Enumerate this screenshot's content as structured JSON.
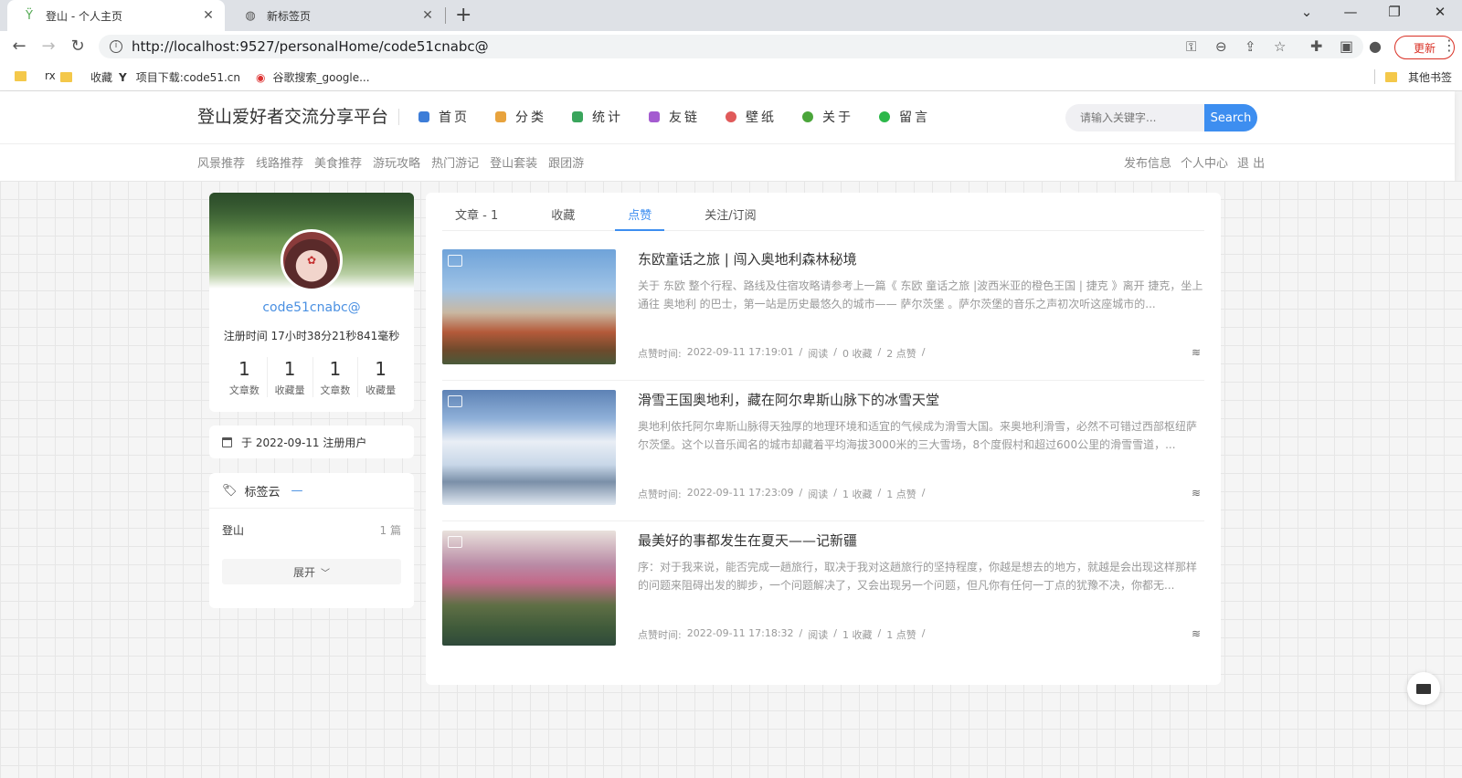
{
  "browser": {
    "tabs": [
      {
        "title": "登山 - 个人主页",
        "active": true
      },
      {
        "title": "新标签页",
        "active": false
      }
    ],
    "url": "http://localhost:9527/personalHome/code51cnabc@",
    "update_label": "更新",
    "bookmarks": [
      "rx",
      "收藏",
      "项目下载:code51.cn",
      "谷歌搜索_google..."
    ],
    "other_bookmarks": "其他书签"
  },
  "header": {
    "site_title": "登山爱好者交流分享平台",
    "nav": [
      {
        "label": "首页",
        "icon": "grid-icon",
        "color": "#3d7dd8"
      },
      {
        "label": "分类",
        "icon": "category-icon",
        "color": "#e8a33d"
      },
      {
        "label": "统计",
        "icon": "stats-icon",
        "color": "#3aa55c"
      },
      {
        "label": "友链",
        "icon": "link-icon",
        "color": "#a45bd0"
      },
      {
        "label": "壁纸",
        "icon": "wallpaper-icon",
        "color": "#e05a5a"
      },
      {
        "label": "关于",
        "icon": "info-icon",
        "color": "#4aa53a"
      },
      {
        "label": "留言",
        "icon": "message-icon",
        "color": "#2db84a"
      }
    ],
    "search_placeholder": "请输入关键字...",
    "search_button": "Search",
    "subnav": [
      "风景推荐",
      "线路推荐",
      "美食推荐",
      "游玩攻略",
      "热门游记",
      "登山套装",
      "跟团游"
    ],
    "usernav": [
      "发布信息",
      "个人中心",
      "退 出"
    ]
  },
  "profile": {
    "username": "code51cnabc@",
    "register_duration": "注册时间 17小时38分21秒841毫秒",
    "stats": [
      {
        "value": "1",
        "label": "文章数"
      },
      {
        "value": "1",
        "label": "收藏量"
      },
      {
        "value": "1",
        "label": "文章数"
      },
      {
        "value": "1",
        "label": "收藏量"
      }
    ],
    "register_note": "于 2022-09-11 注册用户"
  },
  "tag_cloud": {
    "title": "标签云",
    "collapse_symbol": "—",
    "tags": [
      {
        "name": "登山",
        "count": "1 篇"
      }
    ],
    "expand_label": "展开"
  },
  "main": {
    "tabs": [
      {
        "label": "文章 - 1",
        "active": false
      },
      {
        "label": "收藏",
        "active": false
      },
      {
        "label": "点赞",
        "active": true
      },
      {
        "label": "关注/订阅",
        "active": false
      }
    ],
    "articles": [
      {
        "title": "东欧童话之旅 | 闯入奥地利森林秘境",
        "summary": "关于 东欧 整个行程、路线及住宿攻略请参考上一篇《 东欧 童话之旅 |波西米亚的橙色王国 | 捷克 》离开 捷克，坐上通往 奥地利 的巴士，第一站是历史最悠久的城市—— 萨尔茨堡 。萨尔茨堡的音乐之声初次听这座城市的...",
        "meta": [
          "点赞时间:",
          "2022-09-11 17:19:01",
          "/",
          "阅读",
          "/",
          "0 收藏",
          "/",
          "2 点赞",
          "/"
        ]
      },
      {
        "title": "滑雪王国奥地利，藏在阿尔卑斯山脉下的冰雪天堂",
        "summary": "奥地利依托阿尔卑斯山脉得天独厚的地理环境和适宜的气候成为滑雪大国。来奥地利滑雪，必然不可错过西部枢纽萨尔茨堡。这个以音乐闻名的城市却藏着平均海拔3000米的三大雪场，8个度假村和超过600公里的滑雪雪道，...",
        "meta": [
          "点赞时间:",
          "2022-09-11 17:23:09",
          "/",
          "阅读",
          "/",
          "1 收藏",
          "/",
          "1 点赞",
          "/"
        ]
      },
      {
        "title": "最美好的事都发生在夏天——记新疆",
        "summary": "序：对于我来说，能否完成一趟旅行，取决于我对这趟旅行的坚持程度，你越是想去的地方，就越是会出现这样那样的问题来阻碍出发的脚步，一个问题解决了，又会出现另一个问题，但凡你有任何一丁点的犹豫不决，你都无...",
        "meta": [
          "点赞时间:",
          "2022-09-11 17:18:32",
          "/",
          "阅读",
          "/",
          "1 收藏",
          "/",
          "1 点赞",
          "/"
        ]
      }
    ]
  }
}
